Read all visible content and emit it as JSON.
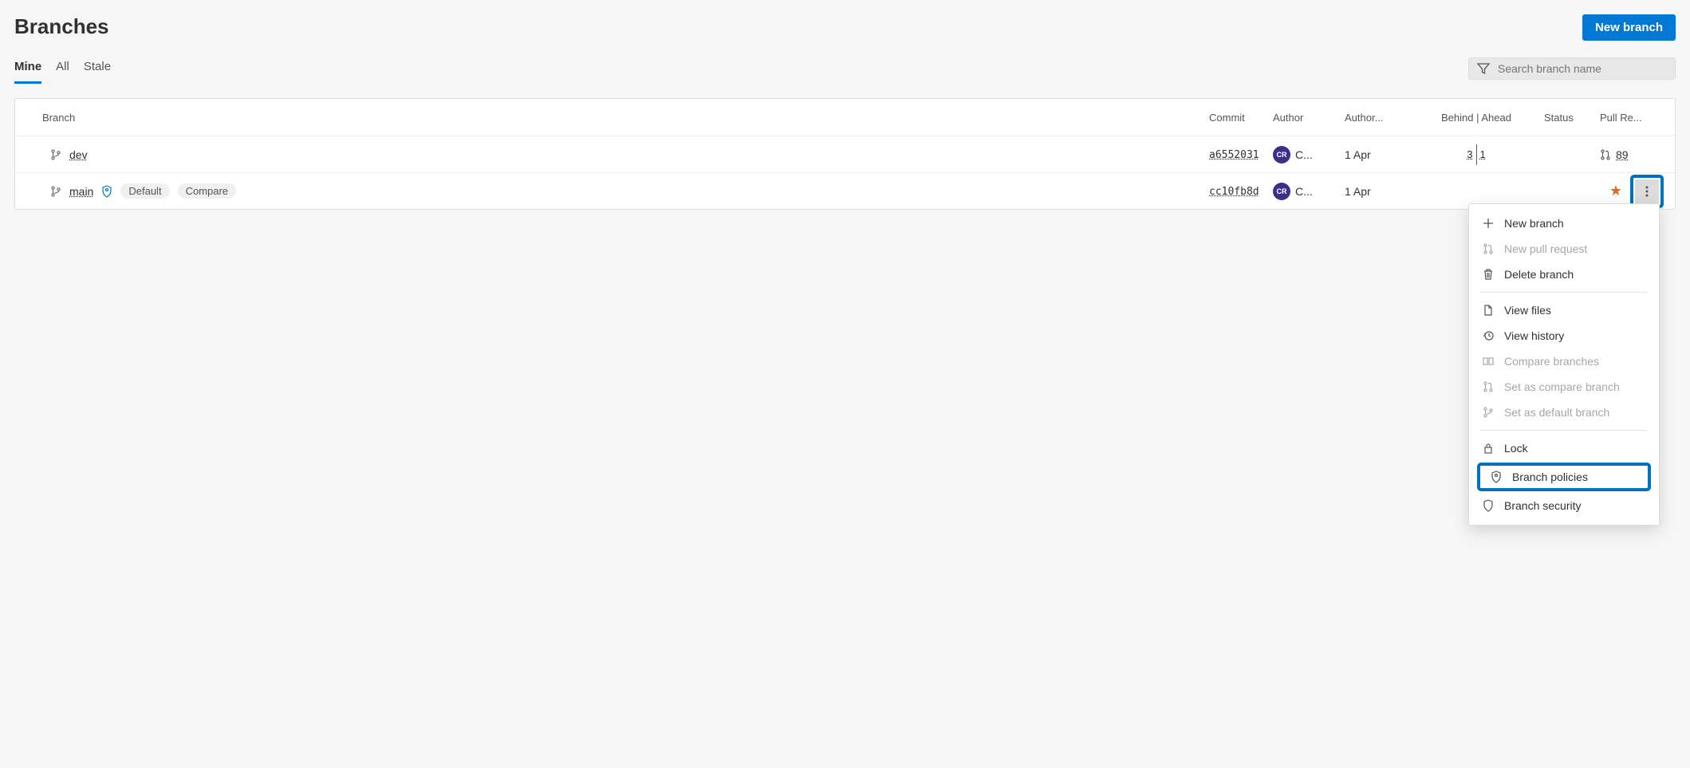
{
  "page": {
    "title": "Branches",
    "new_branch_label": "New branch"
  },
  "tabs": {
    "mine": "Mine",
    "all": "All",
    "stale": "Stale",
    "active": "mine"
  },
  "search": {
    "placeholder": "Search branch name"
  },
  "columns": {
    "branch": "Branch",
    "commit": "Commit",
    "author": "Author",
    "author_date": "Author...",
    "behind_ahead": "Behind | Ahead",
    "status": "Status",
    "pull_request": "Pull Re..."
  },
  "branches": [
    {
      "name": "dev",
      "commit": "a6552031",
      "author_initials": "CR",
      "author_name": "C...",
      "author_date": "1 Apr",
      "behind": "3",
      "ahead": "1",
      "pr": "89",
      "tags": [],
      "favorite": false
    },
    {
      "name": "main",
      "commit": "cc10fb8d",
      "author_initials": "CR",
      "author_name": "C...",
      "author_date": "1 Apr",
      "behind": "",
      "ahead": "",
      "pr": "",
      "tags": [
        "Default",
        "Compare"
      ],
      "favorite": true
    }
  ],
  "menu": {
    "new_branch": "New branch",
    "new_pr": "New pull request",
    "delete_branch": "Delete branch",
    "view_files": "View files",
    "view_history": "View history",
    "compare_branches": "Compare branches",
    "set_compare": "Set as compare branch",
    "set_default": "Set as default branch",
    "lock": "Lock",
    "branch_policies": "Branch policies",
    "branch_security": "Branch security"
  }
}
